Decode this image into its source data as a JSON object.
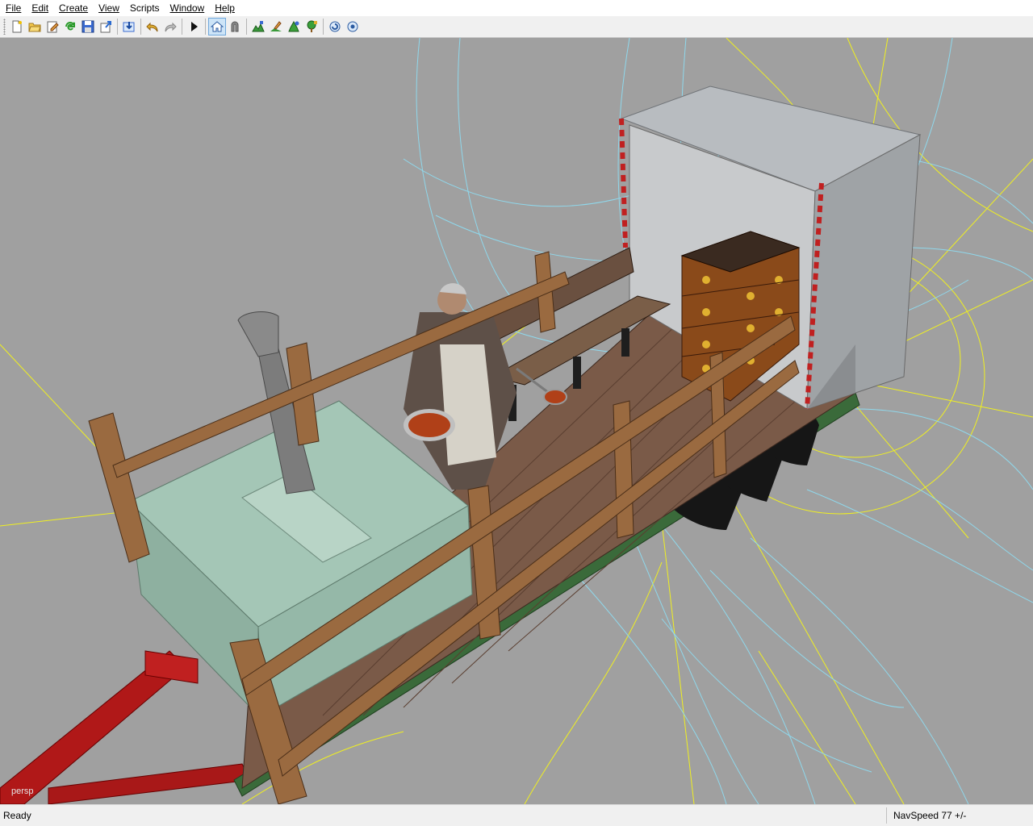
{
  "menu": {
    "file": "File",
    "edit": "Edit",
    "create": "Create",
    "view": "View",
    "scripts": "Scripts",
    "window": "Window",
    "help": "Help"
  },
  "toolbar": {
    "buttons": [
      {
        "name": "new-scene-icon"
      },
      {
        "name": "open-icon"
      },
      {
        "name": "edit-icon"
      },
      {
        "name": "reload-icon"
      },
      {
        "name": "save-icon"
      },
      {
        "name": "export-icon"
      },
      {
        "name": "import-icon"
      },
      {
        "name": "undo-icon"
      },
      {
        "name": "redo-icon"
      },
      {
        "name": "play-icon"
      },
      {
        "name": "home-icon",
        "active": true
      },
      {
        "name": "magnet-icon"
      },
      {
        "name": "terrain-paint-icon"
      },
      {
        "name": "terrain-brush-icon"
      },
      {
        "name": "foliage-paint-icon"
      },
      {
        "name": "tree-paint-icon"
      },
      {
        "name": "refresh-view-icon"
      },
      {
        "name": "settings-view-icon"
      }
    ]
  },
  "viewport": {
    "label": "persp",
    "background": "#a0a0a0",
    "scene": "3D perspective view of a field-kitchen trailer with stove, cook character, bench, covered wagon and stacked crates"
  },
  "status": {
    "text": "Ready",
    "navspeed": "NavSpeed 77 +/-"
  },
  "colors": {
    "wireframe_cyan": "#8fd8ec",
    "wireframe_yellow": "#f0f020",
    "chassis_green": "#3a6a3a",
    "drawbar_red": "#b01818",
    "stove_green": "#a4c6b6",
    "wood_brown": "#8b5a34"
  }
}
